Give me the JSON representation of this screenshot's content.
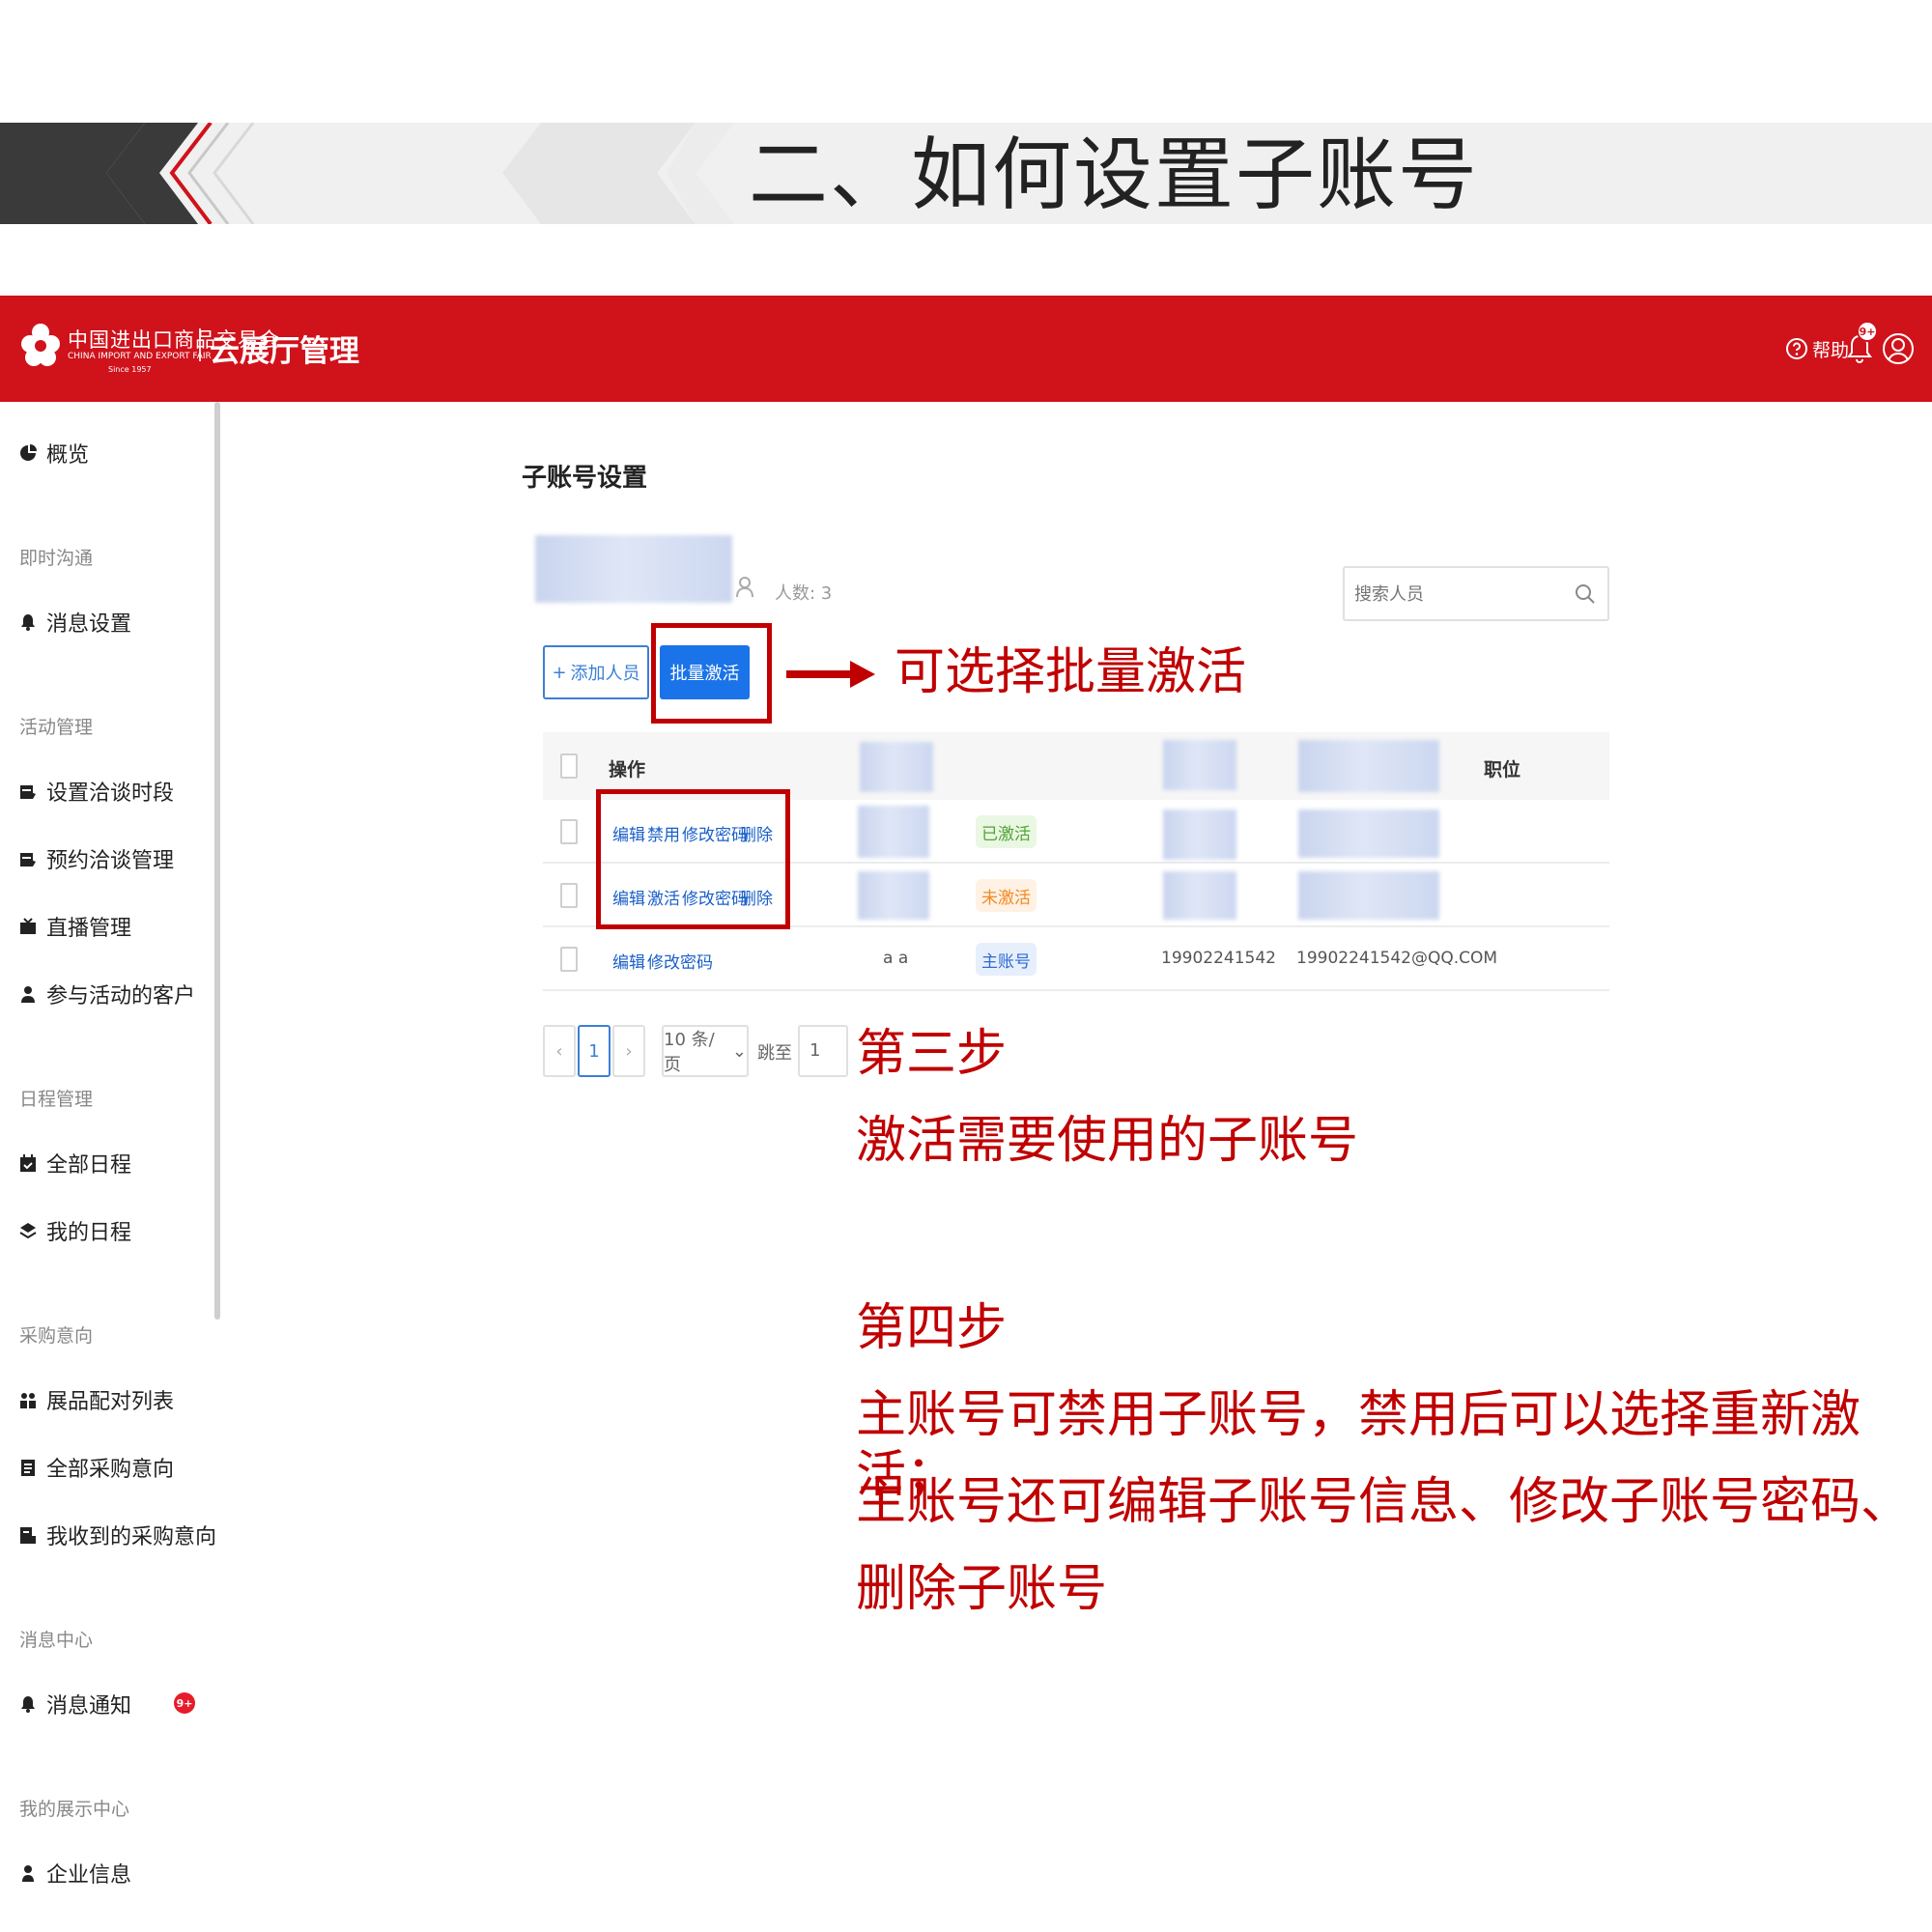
{
  "slide": {
    "title": "二、如何设置子账号"
  },
  "header": {
    "logo_cn": "中国进出口商品交易会",
    "logo_en": "CHINA IMPORT AND EXPORT FAIR",
    "logo_since": "Since 1957",
    "product": "云展厅管理",
    "help_label": "帮助",
    "bell_badge": "9+"
  },
  "sidebar": {
    "overview": "概览",
    "groups": {
      "im": "即时沟通",
      "activity": "活动管理",
      "schedule": "日程管理",
      "purchase": "采购意向",
      "message": "消息中心",
      "showcase": "我的展示中心"
    },
    "items": {
      "msg_settings": "消息设置",
      "set_slots": "设置洽谈时段",
      "appt_mgmt": "预约洽谈管理",
      "live_mgmt": "直播管理",
      "act_customers": "参与活动的客户",
      "all_schedule": "全部日程",
      "my_schedule": "我的日程",
      "match_list": "展品配对列表",
      "all_purchase": "全部采购意向",
      "received_purchase": "我收到的采购意向",
      "notifications": "消息通知",
      "company_info": "企业信息"
    },
    "notify_badge": "9+"
  },
  "main": {
    "title": "子账号设置",
    "members_count": "人数: 3",
    "search_placeholder": "搜索人员",
    "add_button": "添加人员",
    "add_plus": "+",
    "batch_button": "批量激活",
    "table": {
      "col_action": "操作",
      "col_position": "职位",
      "rows": [
        {
          "actions": [
            "编辑",
            "禁用",
            "修改密码",
            "删除"
          ],
          "status": "已激活"
        },
        {
          "actions": [
            "编辑",
            "激活",
            "修改密码",
            "删除"
          ],
          "status": "未激活"
        },
        {
          "actions": [
            "编辑",
            "修改密码"
          ],
          "name": "a a",
          "status": "主账号",
          "phone": "19902241542",
          "email": "19902241542@QQ.COM"
        }
      ]
    },
    "pager": {
      "prev": "‹",
      "current": "1",
      "next": "›",
      "size": "10 条/页",
      "size_chevron": "⌄",
      "jump_label": "跳至",
      "jump_value": "1"
    }
  },
  "annotations": {
    "batch_note": "可选择批量激活",
    "step3_title": "第三步",
    "step3_text": "激活需要使用的子账号",
    "step4_title": "第四步",
    "step4_line1": "主账号可禁用子账号，禁用后可以选择重新激活；",
    "step4_line2": "主账号还可编辑子账号信息、修改子账号密码、",
    "step4_line3": "删除子账号"
  },
  "colors": {
    "brand_red": "#d0121b",
    "annotation_red": "#c00000",
    "primary_blue": "#1a73e8"
  }
}
